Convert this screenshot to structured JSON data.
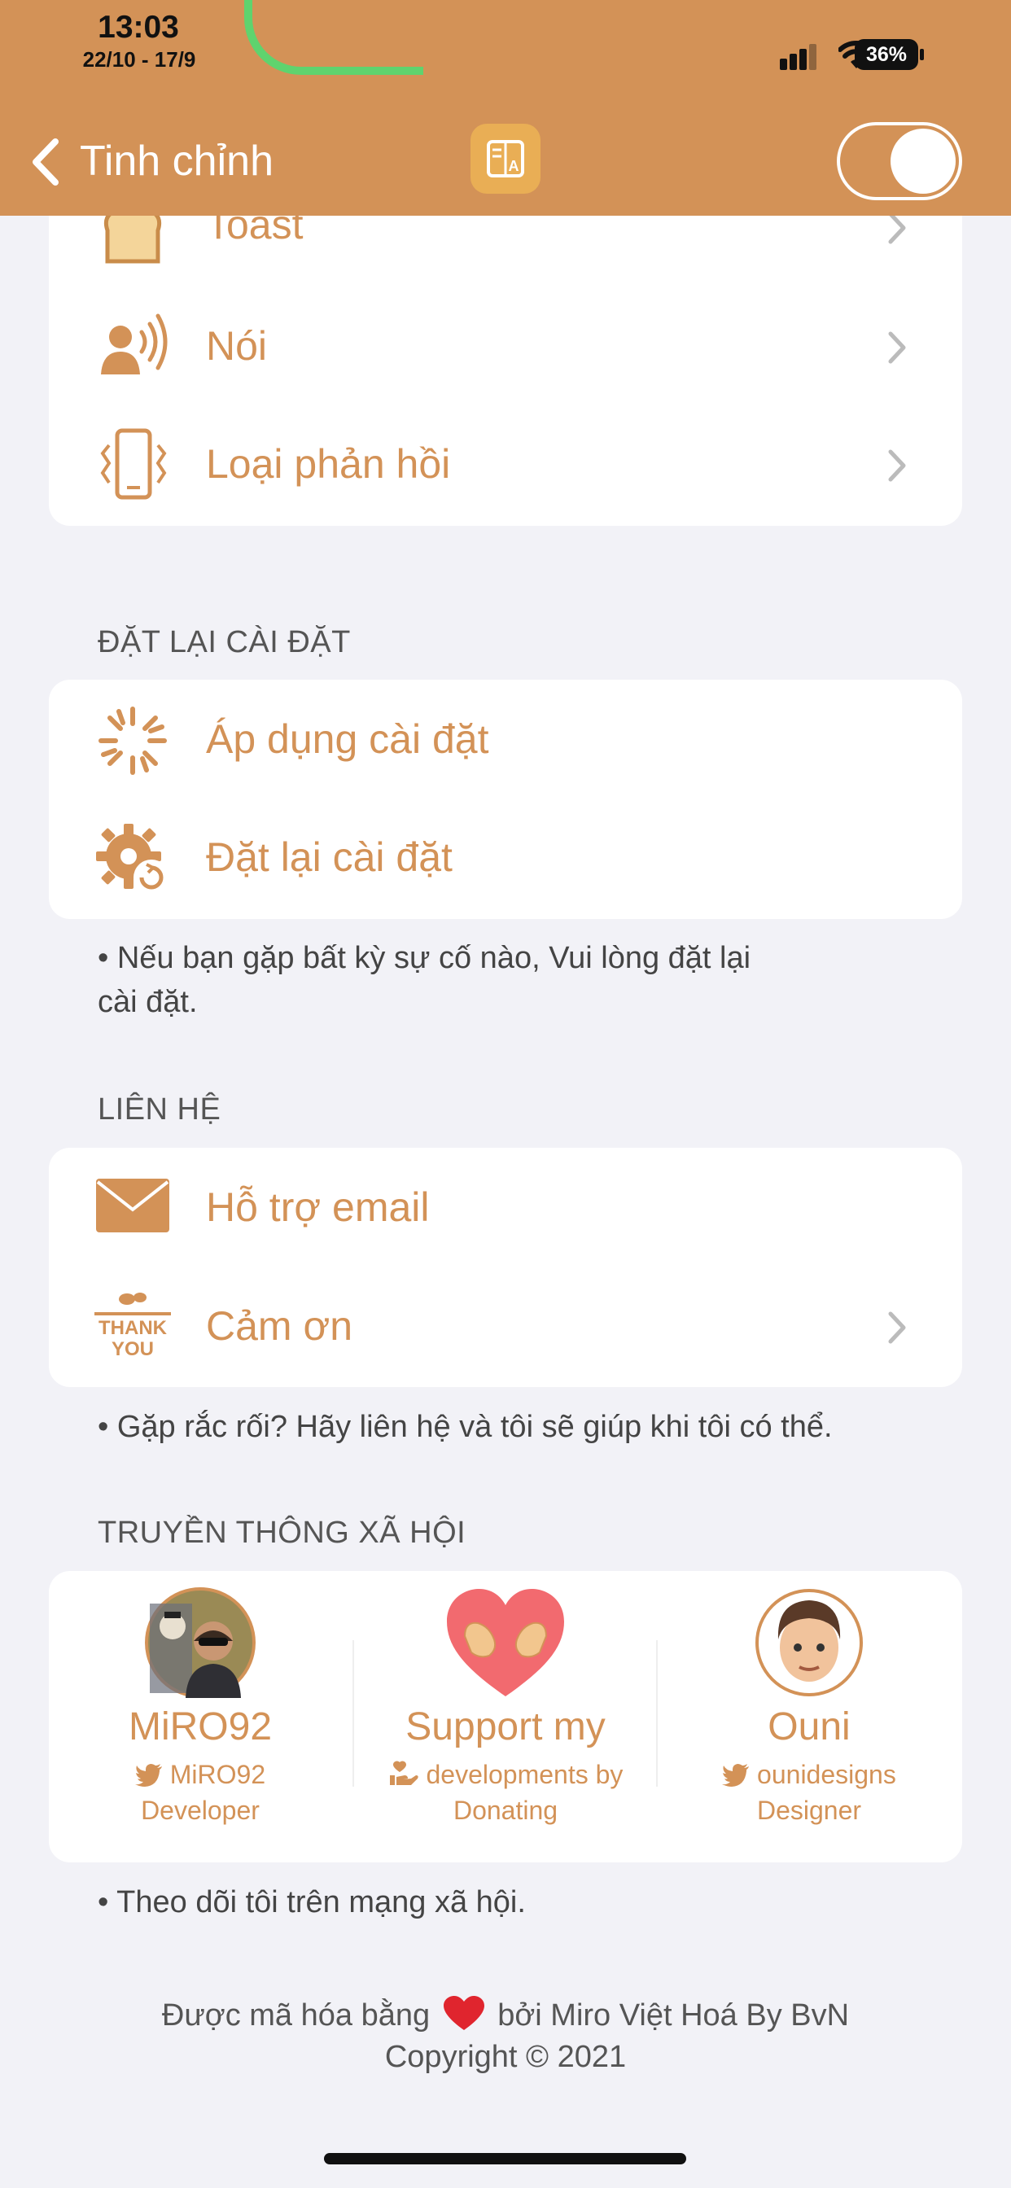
{
  "status_bar": {
    "time": "13:03",
    "date_range": "22/10 - 17/9",
    "battery": "36%"
  },
  "nav": {
    "back_label": "Tinh chỉnh"
  },
  "top_card": {
    "items": [
      {
        "label": "Toast",
        "icon": "toast-icon"
      },
      {
        "label": "Nói",
        "icon": "speaking-person-icon"
      },
      {
        "label": "Loại phản hồi",
        "icon": "haptic-phone-icon"
      }
    ]
  },
  "reset_section": {
    "title": "ĐẶT LẠI CÀI ĐẶT",
    "items": [
      {
        "label": "Áp dụng cài đặt",
        "icon": "loading-spinner-icon"
      },
      {
        "label": "Đặt lại cài đặt",
        "icon": "gear-reset-icon"
      }
    ],
    "note_line1": "• Nếu bạn gặp bất kỳ sự cố nào, Vui lòng đặt lại",
    "note_line2": "cài đặt."
  },
  "contact_section": {
    "title": "LIÊN HỆ",
    "items": [
      {
        "label": "Hỗ trợ email",
        "icon": "envelope-icon"
      },
      {
        "label": "Cảm ơn",
        "icon": "thank-you-icon",
        "icon_text_1": "THANK",
        "icon_text_2": "YOU"
      }
    ],
    "note": "• Gặp rắc rối? Hãy liên hệ và tôi sẽ giúp khi tôi có thể."
  },
  "social_section": {
    "title": "TRUYỀN THÔNG XÃ HỘI",
    "people": [
      {
        "name": "MiRO92",
        "handle": "MiRO92",
        "role": "Developer"
      },
      {
        "name": "Support my",
        "handle": "developments by",
        "role": "Donating"
      },
      {
        "name": "Ouni",
        "handle": "ounidesigns",
        "role": "Designer"
      }
    ],
    "note": "• Theo dõi tôi trên mạng xã hội."
  },
  "footer": {
    "line1_prefix": "Được mã hóa bằng",
    "line1_suffix": "bởi Miro Việt Hoá By BvN",
    "line2": "Copyright © 2021"
  },
  "colors": {
    "accent": "#d39257",
    "background": "#f2f2f7",
    "card": "#ffffff"
  }
}
